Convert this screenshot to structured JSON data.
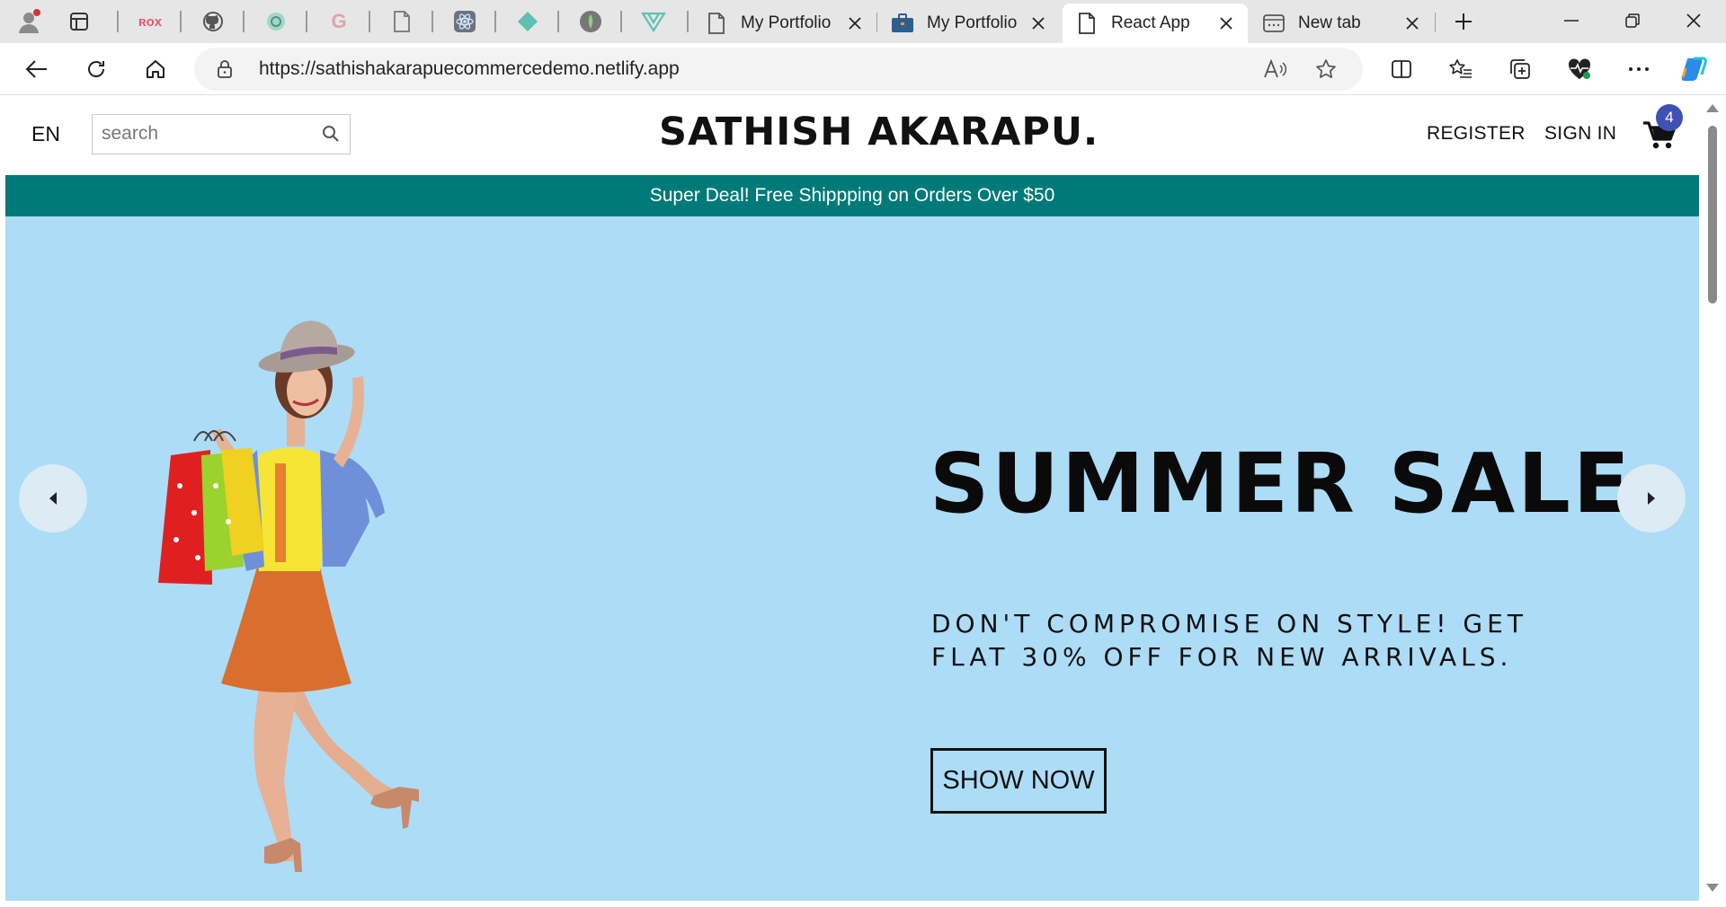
{
  "browser": {
    "tabs": [
      {
        "title": "My Portfolio",
        "favicon": "page-icon",
        "active": false
      },
      {
        "title": "My Portfolio",
        "favicon": "briefcase-icon",
        "active": false
      },
      {
        "title": "React App",
        "favicon": "page-icon",
        "active": true
      },
      {
        "title": "New tab",
        "favicon": "newtab-icon",
        "active": false
      }
    ],
    "pinned_tabs": [
      "tom-icon",
      "github-icon",
      "chatgpt-icon",
      "google-icon",
      "page-icon",
      "react-icon",
      "diamond-icon",
      "mongodb-icon",
      "vercel-icon"
    ],
    "url": "https://sathishakarapuecommercedemo.netlify.app"
  },
  "site": {
    "lang": "EN",
    "search_placeholder": "search",
    "logo": "SATHISH AKARAPU.",
    "nav": {
      "register": "REGISTER",
      "signin": "SIGN IN"
    },
    "cart_count": "4",
    "announcement": "Super Deal! Free Shippping on Orders Over $50",
    "hero": {
      "title": "SUMMER SALE",
      "description": "DON'T COMPROMISE ON STYLE! GET FLAT 30% OFF FOR NEW ARRIVALS.",
      "button": "SHOW NOW"
    }
  },
  "colors": {
    "announcement_bg": "#007a78",
    "hero_bg": "#addcf7",
    "badge_bg": "#3f51b5"
  }
}
